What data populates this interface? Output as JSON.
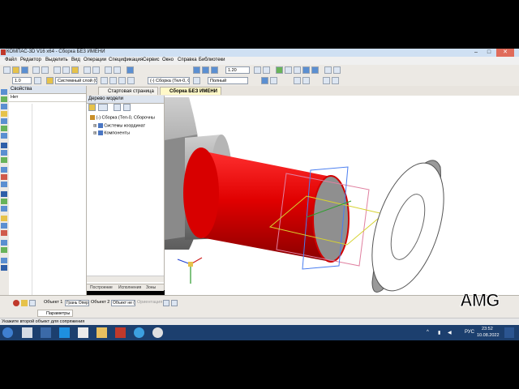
{
  "window": {
    "title": "КОМПАС-3D V16 x64 - Сборка БЕЗ ИМЕНИ"
  },
  "menu": [
    "Файл",
    "Редактор",
    "Выделить",
    "Вид",
    "Операции",
    "Спецификация",
    "Сервис",
    "Окно",
    "Справка",
    "Библиотеки"
  ],
  "toolbar": {
    "scale_value": "1.20",
    "line_width": "1.0",
    "layer_combo": "Системный слой (0)",
    "model_combo": "(-) Сборка (Тел-0, С",
    "style_combo": "Полный"
  },
  "properties_panel": {
    "title": "Свойства",
    "filter": "Нет"
  },
  "model_tree": {
    "title": "Дерево модели",
    "items": [
      "(-) Сборка (Тел-0, Сборочны",
      "Системы координат",
      "Компоненты"
    ],
    "tabs": [
      "Построение",
      "Исполнения",
      "Зоны"
    ]
  },
  "doc_tabs": [
    "Стартовая страница",
    "Сборка БЕЗ ИМЕНИ"
  ],
  "params_bar": {
    "fields": [
      "Объект 1",
      "Грань Опер",
      "Объект 2",
      "Объект не ("
    ],
    "orientation_label": "Ориентация",
    "tab_label": "Параметры"
  },
  "status": {
    "text": "Укажите второй объект для сопряжения"
  },
  "taskbar": {
    "lang": "РУС",
    "time": "23:52",
    "date": "10.08.2022"
  },
  "watermark": "AMG",
  "colors": {
    "red_part": "#d40000",
    "gray_part": "#9a9a9a",
    "title_bg": "#cfe0f3",
    "taskbar": "#1c3f6e"
  }
}
